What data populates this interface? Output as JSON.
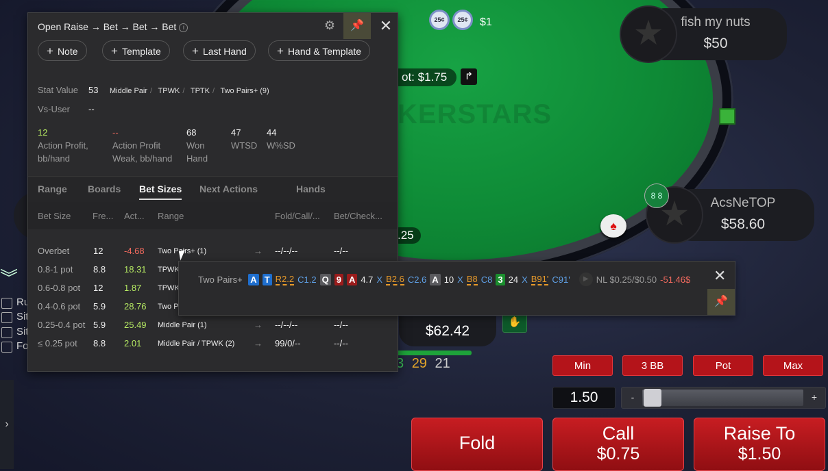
{
  "table": {
    "watermark": "KERSTARS",
    "pot_label": "ot: $1.75",
    "pot_icon": "↱",
    "top_bet_chips": [
      "25¢",
      "25¢"
    ],
    "top_bet_amount": "$1",
    "left_bet": ".25",
    "players": [
      {
        "name": "fish my nuts",
        "stack": "$50"
      },
      {
        "name": "AcsNeTOP",
        "stack": "$58.60"
      }
    ],
    "card_icon_label": "8 8",
    "hero": {
      "stack": "$62.42",
      "nums": [
        {
          "v": "3",
          "color": "#3bbf55"
        },
        {
          "v": "29",
          "color": "#e2a42a"
        },
        {
          "v": "21",
          "color": "#cfcfcf"
        }
      ]
    },
    "left_checkboxes": [
      "Ru",
      "Sit",
      "Sit",
      "Fo"
    ]
  },
  "actions": {
    "presets": [
      "Min",
      "3 BB",
      "Pot",
      "Max"
    ],
    "amount": "1.50",
    "slider_minus": "-",
    "slider_plus": "+",
    "slider_fraction": 0.0,
    "fold": {
      "line1": "Fold",
      "line2": ""
    },
    "call": {
      "line1": "Call",
      "line2": "$0.75"
    },
    "raise": {
      "line1": "Raise To",
      "line2": "$1.50"
    }
  },
  "hud": {
    "title": "Open Raise → Bet → Bet → Bet",
    "info_glyph": "i",
    "buttons": [
      "Note",
      "Template",
      "Last Hand",
      "Hand & Template"
    ],
    "stat_value_label": "Stat Value",
    "stat_value": "53",
    "stat_tags": [
      "Middle Pair",
      "TPWK",
      "TPTK",
      "Two Pairs+ (9)"
    ],
    "vs_user_label": "Vs-User",
    "vs_user_value": "--",
    "stats": [
      {
        "value": "12",
        "label": "Action Profit, bb/hand",
        "color": "#b6ea63"
      },
      {
        "value": "--",
        "label": "Action Profit Weak, bb/hand",
        "color": "#f26a5e"
      },
      {
        "value": "68",
        "label": "Won Hand",
        "color": "#f2f2f2"
      },
      {
        "value": "47",
        "label": "WTSD",
        "color": "#f2f2f2"
      },
      {
        "value": "44",
        "label": "W%SD",
        "color": "#f2f2f2"
      }
    ],
    "tabs": [
      "Range",
      "Boards",
      "Bet Sizes",
      "Next Actions",
      "Hands"
    ],
    "active_tab": "Bet Sizes",
    "columns": [
      "Bet Size",
      "Fre...",
      "Act...",
      "Range",
      "Fold/Call/...",
      "Bet/Check..."
    ],
    "rows": [
      {
        "size": "Overbet",
        "freq": "12",
        "act": "-4.68",
        "act_sign": "neg",
        "range": "Two Pairs+ (1)",
        "fc": "--/--/--",
        "bc": "--/--"
      },
      {
        "size": "0.8-1 pot",
        "freq": "8.8",
        "act": "18.31",
        "act_sign": "pos",
        "range": "TPWK",
        "fc": "",
        "bc": ""
      },
      {
        "size": "0.6-0.8 pot",
        "freq": "12",
        "act": "1.87",
        "act_sign": "pos",
        "range": "TPWK",
        "fc": "",
        "bc": ""
      },
      {
        "size": "0.4-0.6 pot",
        "freq": "5.9",
        "act": "28.76",
        "act_sign": "pos",
        "range": "Two P",
        "fc": "",
        "bc": ""
      },
      {
        "size": "0.25-0.4 pot",
        "freq": "5.9",
        "act": "25.49",
        "act_sign": "pos",
        "range": "Middle Pair (1)",
        "fc": "--/--/--",
        "bc": "--/--"
      },
      {
        "size": "≤ 0.25 pot",
        "freq": "8.8",
        "act": "2.01",
        "act_sign": "pos",
        "range": "Middle Pair / TPWK (2)",
        "fc": "99/0/--",
        "bc": "--/--"
      }
    ],
    "arrow": "→"
  },
  "tooltip": {
    "label": "Two Pairs+",
    "items": [
      {
        "t": "A",
        "s": "blue"
      },
      {
        "t": "T",
        "s": "blue"
      },
      {
        "t": "R2.2",
        "s": "orange"
      },
      {
        "t": "C1.2",
        "s": "lblue"
      },
      {
        "t": "Q",
        "s": "gray"
      },
      {
        "t": "9",
        "s": "red"
      },
      {
        "t": "A",
        "s": "red"
      },
      {
        "t": "4.7",
        "s": "plain"
      },
      {
        "t": "X",
        "s": "lblue"
      },
      {
        "t": "B2.6",
        "s": "orange"
      },
      {
        "t": "C2.6",
        "s": "lblue"
      },
      {
        "t": "A",
        "s": "gray"
      },
      {
        "t": "10",
        "s": "plain"
      },
      {
        "t": "X",
        "s": "lblue"
      },
      {
        "t": "B8",
        "s": "orange"
      },
      {
        "t": "C8",
        "s": "lblue"
      },
      {
        "t": "3",
        "s": "green"
      },
      {
        "t": "24",
        "s": "plain"
      },
      {
        "t": "X",
        "s": "lblue"
      },
      {
        "t": "B91'",
        "s": "orange"
      },
      {
        "t": "C91'",
        "s": "lblue"
      }
    ],
    "play_icon": "▶",
    "stakes": "NL $0.25/$0.50",
    "result": "-51.46$"
  },
  "icons": {
    "close": "✕",
    "pin": "📌",
    "gear": "⚙",
    "chevron": "›",
    "double_chevron": "︾"
  }
}
